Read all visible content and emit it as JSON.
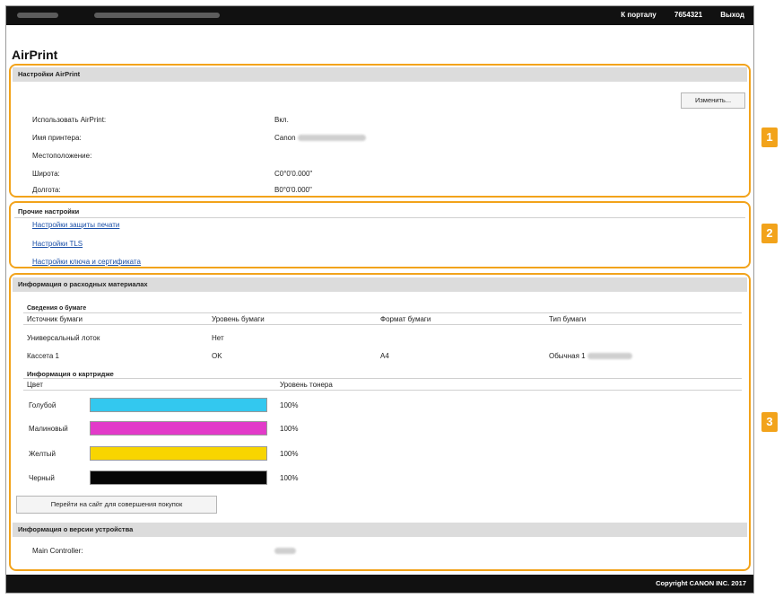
{
  "topbar": {
    "links": [
      "К порталу",
      "7654321",
      "Выход"
    ]
  },
  "page_title": "AirPrint",
  "airprint_settings": {
    "header": "Настройки AirPrint",
    "edit_button": "Изменить...",
    "rows": [
      {
        "label": "Использовать AirPrint:",
        "value": "Вкл."
      },
      {
        "label": "Имя принтера:",
        "value": "Canon"
      },
      {
        "label": "Местоположение:",
        "value": ""
      },
      {
        "label": "Широта:",
        "value": "С0°0'0.000\""
      },
      {
        "label": "Долгота:",
        "value": "В0°0'0.000\""
      }
    ]
  },
  "other_settings": {
    "header": "Прочие настройки",
    "links": [
      "Настройки защиты печати",
      "Настройки TLS",
      "Настройки ключа и сертификата"
    ]
  },
  "consumables": {
    "header": "Информация о расходных материалах",
    "paper_info_title": "Сведения о бумаге",
    "paper_columns": [
      "Источник бумаги",
      "Уровень бумаги",
      "Формат бумаги",
      "Тип бумаги"
    ],
    "paper_rows": [
      [
        "Универсальный лоток",
        "Нет",
        "",
        ""
      ],
      [
        "Кассета 1",
        "OK",
        "A4",
        "Обычная 1"
      ]
    ],
    "cartridge_title": "Информация о картридже",
    "cartridge_columns": [
      "Цвет",
      "Уровень тонера"
    ],
    "cartridges": [
      {
        "name": "Голубой",
        "level": "100%",
        "color": "#33c8ef"
      },
      {
        "name": "Малиновый",
        "level": "100%",
        "color": "#e23bc9"
      },
      {
        "name": "Желтый",
        "level": "100%",
        "color": "#f8d500"
      },
      {
        "name": "Черный",
        "level": "100%",
        "color": "#050505"
      }
    ],
    "shop_button": "Перейти на сайт для совершения покупок"
  },
  "device_version": {
    "header": "Информация о версии устройства",
    "rows": [
      {
        "label": "Main Controller:",
        "value": ""
      }
    ]
  },
  "footer": "Copyright CANON INC. 2017",
  "badges": [
    "1",
    "2",
    "3"
  ],
  "colors": {
    "accent": "#f2a31b",
    "topbar": "#111111",
    "link": "#1a4fa8"
  }
}
